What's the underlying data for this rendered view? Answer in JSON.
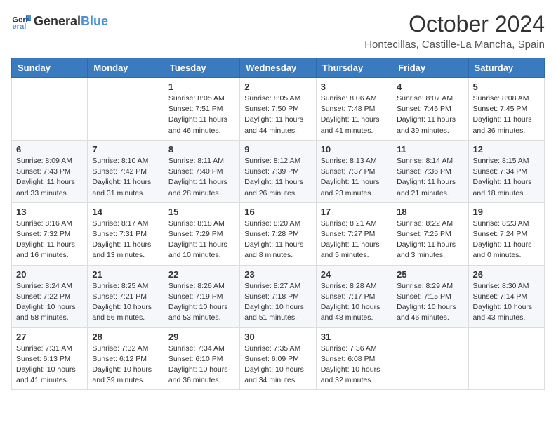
{
  "header": {
    "logo_general": "General",
    "logo_blue": "Blue",
    "month": "October 2024",
    "location": "Hontecillas, Castille-La Mancha, Spain"
  },
  "days_of_week": [
    "Sunday",
    "Monday",
    "Tuesday",
    "Wednesday",
    "Thursday",
    "Friday",
    "Saturday"
  ],
  "weeks": [
    [
      {
        "day": "",
        "info": ""
      },
      {
        "day": "",
        "info": ""
      },
      {
        "day": "1",
        "info": "Sunrise: 8:05 AM\nSunset: 7:51 PM\nDaylight: 11 hours and 46 minutes."
      },
      {
        "day": "2",
        "info": "Sunrise: 8:05 AM\nSunset: 7:50 PM\nDaylight: 11 hours and 44 minutes."
      },
      {
        "day": "3",
        "info": "Sunrise: 8:06 AM\nSunset: 7:48 PM\nDaylight: 11 hours and 41 minutes."
      },
      {
        "day": "4",
        "info": "Sunrise: 8:07 AM\nSunset: 7:46 PM\nDaylight: 11 hours and 39 minutes."
      },
      {
        "day": "5",
        "info": "Sunrise: 8:08 AM\nSunset: 7:45 PM\nDaylight: 11 hours and 36 minutes."
      }
    ],
    [
      {
        "day": "6",
        "info": "Sunrise: 8:09 AM\nSunset: 7:43 PM\nDaylight: 11 hours and 33 minutes."
      },
      {
        "day": "7",
        "info": "Sunrise: 8:10 AM\nSunset: 7:42 PM\nDaylight: 11 hours and 31 minutes."
      },
      {
        "day": "8",
        "info": "Sunrise: 8:11 AM\nSunset: 7:40 PM\nDaylight: 11 hours and 28 minutes."
      },
      {
        "day": "9",
        "info": "Sunrise: 8:12 AM\nSunset: 7:39 PM\nDaylight: 11 hours and 26 minutes."
      },
      {
        "day": "10",
        "info": "Sunrise: 8:13 AM\nSunset: 7:37 PM\nDaylight: 11 hours and 23 minutes."
      },
      {
        "day": "11",
        "info": "Sunrise: 8:14 AM\nSunset: 7:36 PM\nDaylight: 11 hours and 21 minutes."
      },
      {
        "day": "12",
        "info": "Sunrise: 8:15 AM\nSunset: 7:34 PM\nDaylight: 11 hours and 18 minutes."
      }
    ],
    [
      {
        "day": "13",
        "info": "Sunrise: 8:16 AM\nSunset: 7:32 PM\nDaylight: 11 hours and 16 minutes."
      },
      {
        "day": "14",
        "info": "Sunrise: 8:17 AM\nSunset: 7:31 PM\nDaylight: 11 hours and 13 minutes."
      },
      {
        "day": "15",
        "info": "Sunrise: 8:18 AM\nSunset: 7:29 PM\nDaylight: 11 hours and 10 minutes."
      },
      {
        "day": "16",
        "info": "Sunrise: 8:20 AM\nSunset: 7:28 PM\nDaylight: 11 hours and 8 minutes."
      },
      {
        "day": "17",
        "info": "Sunrise: 8:21 AM\nSunset: 7:27 PM\nDaylight: 11 hours and 5 minutes."
      },
      {
        "day": "18",
        "info": "Sunrise: 8:22 AM\nSunset: 7:25 PM\nDaylight: 11 hours and 3 minutes."
      },
      {
        "day": "19",
        "info": "Sunrise: 8:23 AM\nSunset: 7:24 PM\nDaylight: 11 hours and 0 minutes."
      }
    ],
    [
      {
        "day": "20",
        "info": "Sunrise: 8:24 AM\nSunset: 7:22 PM\nDaylight: 10 hours and 58 minutes."
      },
      {
        "day": "21",
        "info": "Sunrise: 8:25 AM\nSunset: 7:21 PM\nDaylight: 10 hours and 56 minutes."
      },
      {
        "day": "22",
        "info": "Sunrise: 8:26 AM\nSunset: 7:19 PM\nDaylight: 10 hours and 53 minutes."
      },
      {
        "day": "23",
        "info": "Sunrise: 8:27 AM\nSunset: 7:18 PM\nDaylight: 10 hours and 51 minutes."
      },
      {
        "day": "24",
        "info": "Sunrise: 8:28 AM\nSunset: 7:17 PM\nDaylight: 10 hours and 48 minutes."
      },
      {
        "day": "25",
        "info": "Sunrise: 8:29 AM\nSunset: 7:15 PM\nDaylight: 10 hours and 46 minutes."
      },
      {
        "day": "26",
        "info": "Sunrise: 8:30 AM\nSunset: 7:14 PM\nDaylight: 10 hours and 43 minutes."
      }
    ],
    [
      {
        "day": "27",
        "info": "Sunrise: 7:31 AM\nSunset: 6:13 PM\nDaylight: 10 hours and 41 minutes."
      },
      {
        "day": "28",
        "info": "Sunrise: 7:32 AM\nSunset: 6:12 PM\nDaylight: 10 hours and 39 minutes."
      },
      {
        "day": "29",
        "info": "Sunrise: 7:34 AM\nSunset: 6:10 PM\nDaylight: 10 hours and 36 minutes."
      },
      {
        "day": "30",
        "info": "Sunrise: 7:35 AM\nSunset: 6:09 PM\nDaylight: 10 hours and 34 minutes."
      },
      {
        "day": "31",
        "info": "Sunrise: 7:36 AM\nSunset: 6:08 PM\nDaylight: 10 hours and 32 minutes."
      },
      {
        "day": "",
        "info": ""
      },
      {
        "day": "",
        "info": ""
      }
    ]
  ]
}
